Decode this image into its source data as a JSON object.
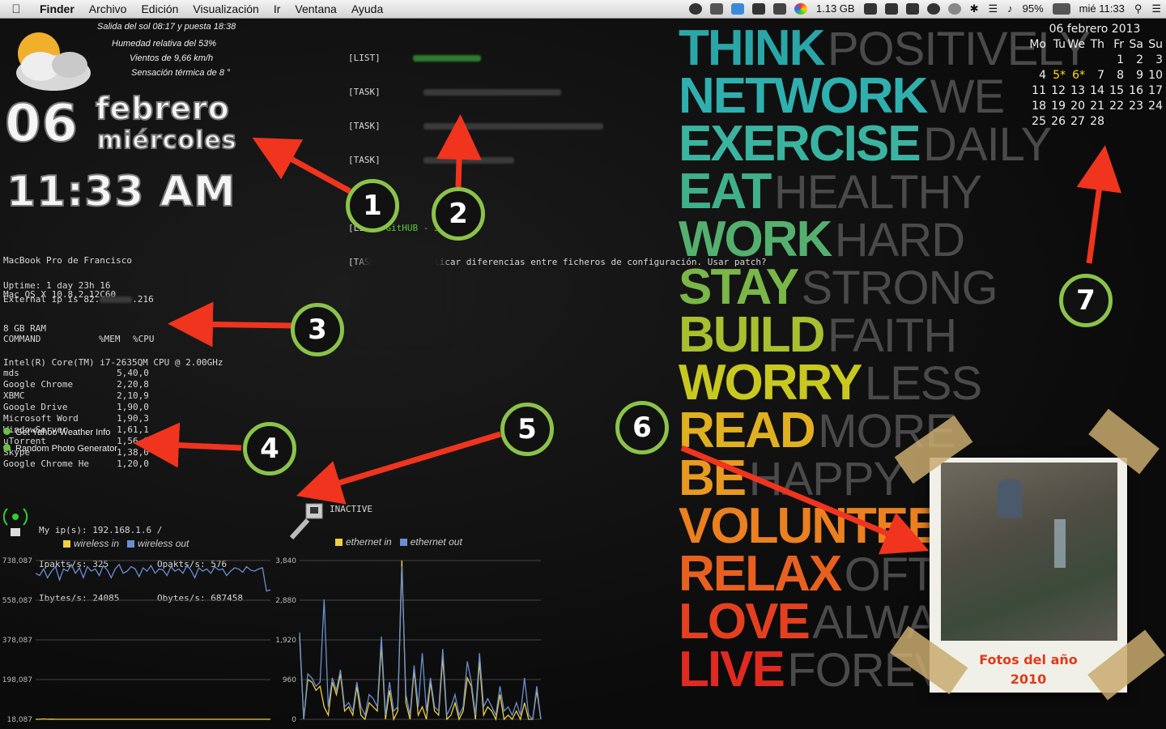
{
  "menubar": {
    "app": "Finder",
    "menus": [
      "Archivo",
      "Edición",
      "Visualización",
      "Ir",
      "Ventana",
      "Ayuda"
    ],
    "memory": "1.13 GB",
    "battery": "95%",
    "clock": "mié 11:33"
  },
  "weather": {
    "line1": "Salida del sol 08:17 y puesta 18:38",
    "line2": "Humedad relativa del 53%",
    "line3": "Vientos de 9,66 km/h",
    "line4": "Sensación térmica de 8 °"
  },
  "date_widget": {
    "day": "06",
    "month": "febrero",
    "weekday": "miércoles",
    "time": "11:33 AM"
  },
  "tasks": {
    "lines": [
      {
        "tag": "[LIST]",
        "text": "GitHUB - JOOSY"
      },
      {
        "tag": "[TASK]",
        "text": "Aplicar diferencias entre ficheros de configuración. Usar patch?"
      }
    ],
    "blurred_tags": [
      "[LIST]",
      "[TASK]",
      "[TASK]",
      "[TASK]"
    ]
  },
  "sysinfo": {
    "lines": [
      "MacBook Pro de Francisco",
      "Mac OS X 10.8.2 12C60",
      "8 GB RAM",
      "Intel(R) Core(TM) i7-2635QM CPU @ 2.00GHz"
    ],
    "uptime": "Uptime: 1 day 23h 16",
    "external_ip_prefix": "External ip is 82.",
    "external_ip_suffix": ".216"
  },
  "processes": {
    "headers": [
      "COMMAND",
      "%MEM",
      "%CPU"
    ],
    "rows": [
      [
        "mds",
        "5,4",
        "0,0"
      ],
      [
        "Google Chrome",
        "2,2",
        "0,8"
      ],
      [
        "XBMC",
        "2,1",
        "0,9"
      ],
      [
        "Google Drive",
        "1,9",
        "0,0"
      ],
      [
        "Microsoft Word",
        "1,9",
        "0,3"
      ],
      [
        "WindowServer",
        "1,6",
        "1,1"
      ],
      [
        "uTorrent",
        "1,5",
        "6,9"
      ],
      [
        "Skype",
        "1,3",
        "8,0"
      ],
      [
        "Google Chrome He",
        "1,2",
        "0,0"
      ]
    ]
  },
  "launchers": [
    "Get Yahoo Weather Info",
    "Random Photo Generator"
  ],
  "network": {
    "myip": "My ip(s): 192.168.1.6 /",
    "ipakts": "Ipakts/s: 325",
    "opakts": "Opakts/s: 576",
    "ibytes": "Ibytes/s: 24085",
    "obytes": "Obytes/s: 687458",
    "ethernet_status": "INACTIVE"
  },
  "chart_data": [
    {
      "type": "line",
      "series": [
        {
          "name": "wireless in",
          "color": "#f0d040",
          "values": [
            18087,
            18087,
            20000,
            18087,
            19000,
            18087,
            18087,
            18087,
            18087,
            18087,
            18087,
            18087,
            18087,
            18087,
            18087,
            18087,
            18087,
            18087,
            18087,
            18087,
            18087,
            18087,
            18087,
            18087,
            18087,
            18087,
            18087,
            18087,
            18087,
            18087,
            18087,
            18087,
            18087,
            18087,
            18087,
            18087,
            18087,
            18087,
            18087,
            18087,
            18087,
            18087,
            18087,
            18087,
            18087,
            18087,
            18087,
            18087,
            18087,
            18087,
            18087,
            18087,
            18087,
            18087,
            18087,
            18087,
            18087,
            18087,
            18087,
            18087
          ]
        },
        {
          "name": "wireless out",
          "color": "#6a8fd0",
          "values": [
            680000,
            670000,
            700000,
            660000,
            690000,
            710000,
            650000,
            700000,
            690000,
            720000,
            680000,
            705000,
            660000,
            710000,
            690000,
            700000,
            670000,
            715000,
            695000,
            660000,
            700000,
            720000,
            680000,
            690000,
            710000,
            700000,
            665000,
            705000,
            690000,
            715000,
            680000,
            700000,
            695000,
            670000,
            710000,
            690000,
            700000,
            680000,
            715000,
            695000,
            660000,
            705000,
            690000,
            700000,
            680000,
            710000,
            695000,
            700000,
            670000,
            690000,
            705000,
            700000,
            685000,
            710000,
            695000,
            690000,
            700000,
            705000,
            600000,
            605000
          ]
        }
      ],
      "ylim": [
        18087,
        738087
      ],
      "yticks": [
        "738,087",
        "558,087",
        "378,087",
        "198,087",
        "18,087"
      ],
      "grid": true,
      "legend": "top"
    },
    {
      "type": "line",
      "series": [
        {
          "name": "ethernet in",
          "color": "#f0d040",
          "values": [
            2000,
            0,
            960,
            900,
            700,
            800,
            300,
            100,
            900,
            600,
            1100,
            200,
            300,
            100,
            800,
            100,
            0,
            400,
            300,
            200,
            1800,
            0,
            700,
            0,
            200,
            3840,
            400,
            0,
            1200,
            100,
            300,
            0,
            900,
            200,
            100,
            1500,
            0,
            100,
            400,
            0,
            200,
            1000,
            800,
            0,
            1400,
            100,
            300,
            200,
            0,
            600,
            0,
            100,
            0,
            200,
            0,
            400,
            0,
            0,
            700,
            0
          ]
        },
        {
          "name": "ethernet out",
          "color": "#6a8fd0",
          "values": [
            2100,
            0,
            1100,
            1000,
            800,
            900,
            2900,
            300,
            1000,
            700,
            1200,
            300,
            400,
            200,
            900,
            300,
            100,
            600,
            500,
            300,
            2000,
            100,
            900,
            200,
            300,
            3700,
            600,
            100,
            1300,
            300,
            1600,
            200,
            1000,
            300,
            200,
            1700,
            100,
            300,
            600,
            100,
            300,
            1400,
            900,
            100,
            1600,
            300,
            500,
            300,
            100,
            800,
            200,
            300,
            100,
            400,
            100,
            1000,
            100,
            0,
            800,
            0
          ]
        }
      ],
      "ylim": [
        0,
        3840
      ],
      "yticks": [
        "3,840",
        "2,880",
        "1,920",
        "960",
        "0"
      ],
      "grid": true,
      "legend": "top"
    }
  ],
  "poster": {
    "rows": [
      {
        "a": "THINK",
        "b": "POSITIVELY",
        "color": "#2aa6a8"
      },
      {
        "a": "NETWORK",
        "b": "WE",
        "color": "#2fb0ae"
      },
      {
        "a": "EXERCISE",
        "b": "DAILY",
        "color": "#3ab4a0"
      },
      {
        "a": "EAT",
        "b": "HEALTHY",
        "color": "#40b08a"
      },
      {
        "a": "WORK",
        "b": "HARD",
        "color": "#55b070"
      },
      {
        "a": "STAY",
        "b": "STRONG",
        "color": "#7ab648"
      },
      {
        "a": "BUILD",
        "b": "FAITH",
        "color": "#a8c030"
      },
      {
        "a": "WORRY",
        "b": "LESS",
        "color": "#c8c820"
      },
      {
        "a": "READ",
        "b": "MORE",
        "color": "#e0b020"
      },
      {
        "a": "BE",
        "b": "HAPPY",
        "color": "#e89a20"
      },
      {
        "a": "VOLUNTEER",
        "b": "",
        "color": "#ea8020"
      },
      {
        "a": "RELAX",
        "b": "OFTEN",
        "color": "#e86020"
      },
      {
        "a": "LOVE",
        "b": "ALWAYS",
        "color": "#e44020"
      },
      {
        "a": "LIVE",
        "b": "FOREVER",
        "color": "#e02a20"
      }
    ]
  },
  "calendar": {
    "title": "06 febrero 2013",
    "weekdays": [
      "Mo",
      "Tu",
      "We",
      "Th",
      "Fr",
      "Sa",
      "Su"
    ],
    "weeks": [
      [
        "",
        "",
        "",
        "",
        "1",
        "2",
        "3"
      ],
      [
        "4",
        "5*",
        "6*",
        "7",
        "8",
        "9",
        "10"
      ],
      [
        "11",
        "12",
        "13",
        "14",
        "15",
        "16",
        "17"
      ],
      [
        "18",
        "19",
        "20",
        "21",
        "22",
        "23",
        "24"
      ],
      [
        "25",
        "26",
        "27",
        "28",
        "",
        "",
        ""
      ]
    ]
  },
  "photo": {
    "caption_line1": "Fotos del año",
    "caption_line2": "2010"
  },
  "annotations": [
    "1",
    "2",
    "3",
    "4",
    "5",
    "6",
    "7"
  ],
  "colors": {
    "annotation_arrow": "#f0341e",
    "annotation_ring": "#8bc34a"
  }
}
